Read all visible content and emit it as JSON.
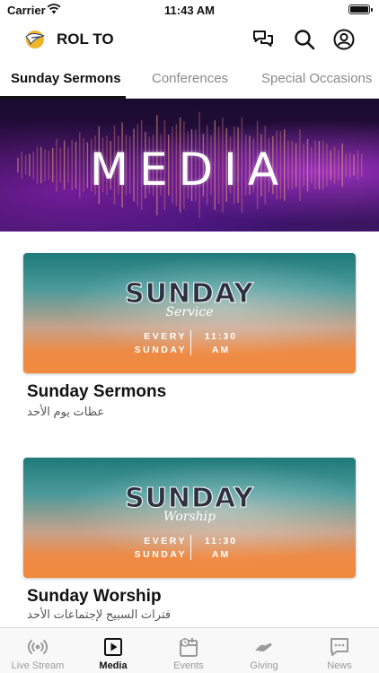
{
  "status_bar": {
    "carrier": "Carrier",
    "time": "11:43 AM",
    "icons": [
      "wifi-icon",
      "battery-icon"
    ]
  },
  "header": {
    "title": "ROL TO",
    "icons": [
      "logo-icon",
      "chat-icon",
      "search-icon",
      "account-icon"
    ]
  },
  "tabs": [
    {
      "label": "Sunday Sermons",
      "active": true
    },
    {
      "label": "Conferences",
      "active": false
    },
    {
      "label": "Special Occasions",
      "active": false
    }
  ],
  "hero": {
    "title": "MEDIA"
  },
  "cards": [
    {
      "banner_headline": "SUNDAY",
      "banner_script": "Service",
      "banner_schedule_left": [
        "EVERY",
        "SUNDAY"
      ],
      "banner_schedule_right": [
        "11:30",
        "AM"
      ],
      "title": "Sunday Sermons",
      "subtitle": "عظات يوم الأحد"
    },
    {
      "banner_headline": "SUNDAY",
      "banner_script": "Worship",
      "banner_schedule_left": [
        "EVERY",
        "SUNDAY"
      ],
      "banner_schedule_right": [
        "11:30",
        "AM"
      ],
      "title": "Sunday Worship",
      "subtitle": "فترات السبيح لإجتماعات الأحد"
    }
  ],
  "bottom_nav": [
    {
      "label": "Live Stream",
      "icon": "live-stream-icon",
      "active": false
    },
    {
      "label": "Media",
      "icon": "media-play-icon",
      "active": true
    },
    {
      "label": "Events",
      "icon": "events-calendar-icon",
      "active": false
    },
    {
      "label": "Giving",
      "icon": "giving-hand-icon",
      "active": false
    },
    {
      "label": "News",
      "icon": "news-chat-icon",
      "active": false
    }
  ],
  "colors": {
    "active": "#111111",
    "inactive": "#9a9a9a",
    "hero_purple": "#3d1566"
  }
}
